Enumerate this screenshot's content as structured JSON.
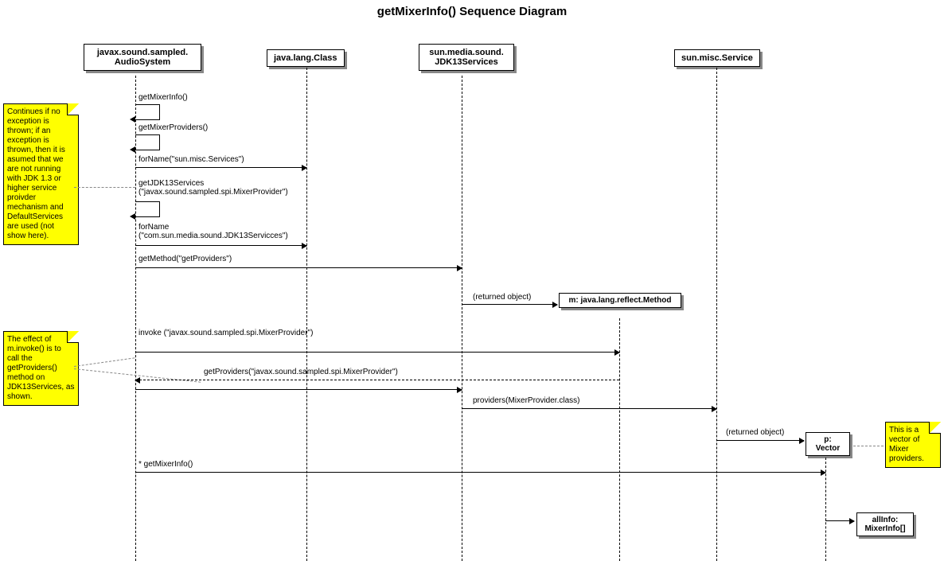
{
  "title": "getMixerInfo() Sequence Diagram",
  "lifelines": {
    "audioSystem": "javax.sound.sampled.\nAudioSystem",
    "klass": "java.lang.Class",
    "jdk13": "sun.media.sound.\nJDK13Services",
    "service": "sun.misc.Service"
  },
  "notes": {
    "note1": "Continues if no exception is thrown; if an exception is thrown, then it is asumed that we are not running with JDK 1.3 or higher service proivder mechanism and DefaultServices are used (not show here).",
    "note2": "The effect of m.invoke() is to call the getProviders() method on JDK13Services, as shown.",
    "note3": "This is a vector of Mixer providers."
  },
  "objects": {
    "m": "m:\njava.lang.reflect.Method",
    "p": "p:\nVector",
    "allInfo": "allInfo:\nMixerInfo[]"
  },
  "messages": {
    "m1": "getMixerInfo()",
    "m2": "getMixerProviders()",
    "m3": "forName(\"sun.misc.Services\")",
    "m4": "getJDK13Services (\"javax.sound.sampled.spi.MixerProvider\")",
    "m5": "forName (\"com.sun.media.sound.JDK13Servicces\")",
    "m6": "getMethod(\"getProviders\")",
    "m7": "(returned object)",
    "m8": "invoke (\"javax.sound.sampled.spi.MixerProvider\")",
    "m9": "getProviders(\"javax.sound.sampled.spi.MixerProvider\")",
    "m10": "providers(MixerProvider.class)",
    "m11": "(returned object)",
    "m12": "* getMixerInfo()"
  }
}
